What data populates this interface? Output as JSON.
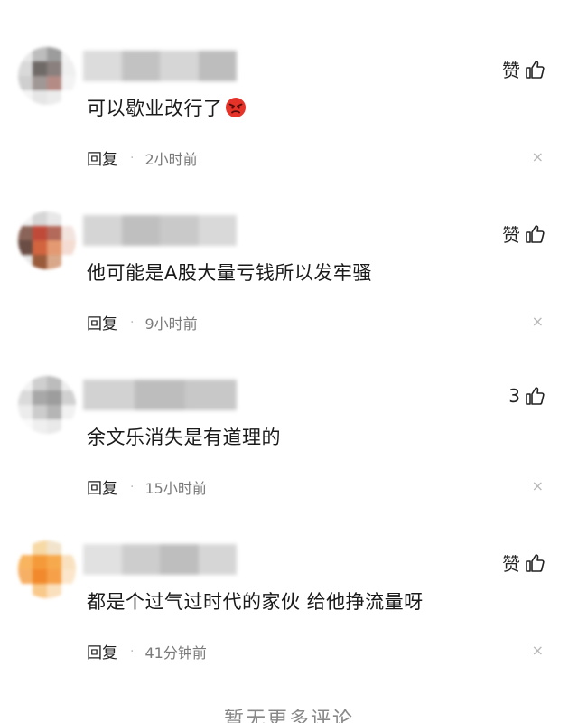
{
  "comments": [
    {
      "text": "可以歇业改行了",
      "emoji": "angry-face-emoji",
      "like_label": "赞",
      "reply_label": "回复",
      "time": "2小时前",
      "close": "×",
      "avatar_colors": [
        "#e8e8e8",
        "#bdbdbd",
        "#9c9c9c",
        "#f2f2f2",
        "#d9d9d9",
        "#6f6a68",
        "#8a807e",
        "#efefef",
        "#cfcfcf",
        "#a09896",
        "#b58b86",
        "#f3f3f3",
        "#f5f5f5",
        "#e6e6e6",
        "#ececec",
        "#ffffff"
      ],
      "name_colors": [
        "#dcdcdc",
        "#c2c2c2",
        "#d6d6d6",
        "#bdbdbd"
      ]
    },
    {
      "text": "他可能是A股大量亏钱所以发牢骚",
      "like_label": "赞",
      "reply_label": "回复",
      "time": "9小时前",
      "close": "×",
      "avatar_colors": [
        "#f1f1f1",
        "#d6d6d6",
        "#e8e8e8",
        "#ffffff",
        "#8a6458",
        "#c04a3a",
        "#b46a5a",
        "#f3e3df",
        "#6a4d44",
        "#d2643f",
        "#e39a72",
        "#f4dcd2",
        "#e7e7e7",
        "#9a5b3b",
        "#d9a88a",
        "#ffffff"
      ],
      "name_colors": [
        "#d5d5d5",
        "#bfbfbf",
        "#c9c9c9",
        "#d9d9d9"
      ]
    },
    {
      "text": "余文乐消失是有道理的",
      "like_count": "3",
      "reply_label": "回复",
      "time": "15小时前",
      "close": "×",
      "avatar_colors": [
        "#f2f2f2",
        "#cfcfcf",
        "#bcbcbc",
        "#ededed",
        "#dadada",
        "#a8a8a8",
        "#9d9d9d",
        "#d0d0d0",
        "#ececec",
        "#cccccc",
        "#b5b5b5",
        "#f1f1f1",
        "#fafafa",
        "#efefef",
        "#e9e9e9",
        "#ffffff"
      ],
      "name_colors": [
        "#d2d2d2",
        "#bdbdbd",
        "#c8c8c8"
      ]
    },
    {
      "text": "都是个过气过时代的家伙 给他挣流量呀",
      "like_label": "赞",
      "reply_label": "回复",
      "time": "41分钟前",
      "close": "×",
      "avatar_colors": [
        "#ffffff",
        "#f7d9a6",
        "#f2e4cc",
        "#ffffff",
        "#f8b45f",
        "#f59a3a",
        "#f7a94d",
        "#f9e1c0",
        "#f6b066",
        "#f2892c",
        "#f6a14a",
        "#fbe6cb",
        "#ffffff",
        "#f9c98b",
        "#fbe0bd",
        "#ffffff"
      ],
      "name_colors": [
        "#e1e1e1",
        "#cdcdcd",
        "#bebebe",
        "#d6d6d6"
      ]
    }
  ],
  "footer_text": "暂无更多评论",
  "colors": {
    "text": "#1a1a1a",
    "meta": "#7a7a7a",
    "close": "#b8b8b8",
    "footer": "#888888"
  }
}
